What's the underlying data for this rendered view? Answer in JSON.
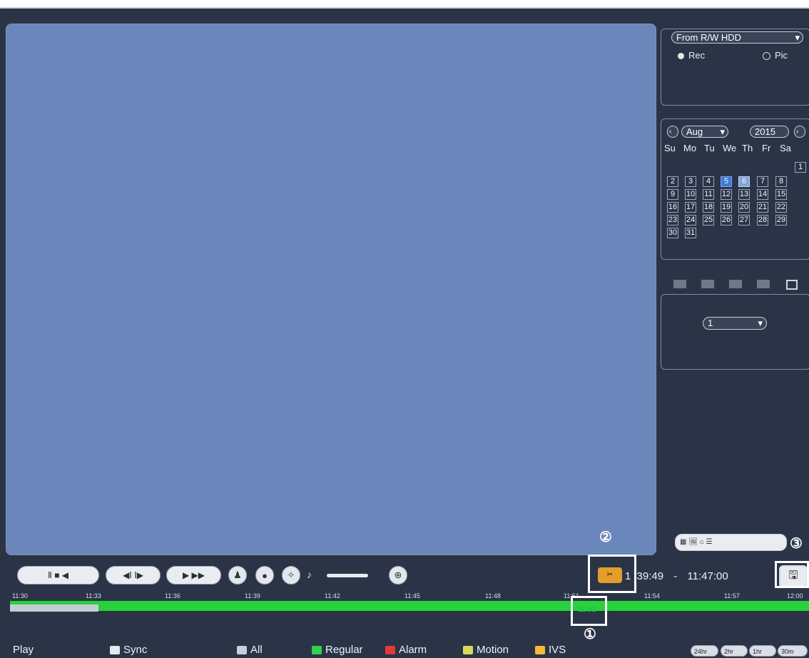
{
  "source": {
    "selected": "From R/W HDD",
    "rec_label": "Rec",
    "pic_label": "Pic"
  },
  "calendar": {
    "month": "Aug",
    "year": "2015",
    "weekdays": [
      "Su",
      "Mo",
      "Tu",
      "We",
      "Th",
      "Fr",
      "Sa"
    ],
    "days": [
      "1",
      "2",
      "3",
      "4",
      "5",
      "6",
      "7",
      "8",
      "9",
      "10",
      "11",
      "12",
      "13",
      "14",
      "15",
      "16",
      "17",
      "18",
      "19",
      "20",
      "21",
      "22",
      "23",
      "24",
      "25",
      "26",
      "27",
      "28",
      "29",
      "30",
      "31"
    ]
  },
  "channel": {
    "selected": "1"
  },
  "time": {
    "start": "1",
    "start_rest": "39:49",
    "dash": "-",
    "end": "11:47:00"
  },
  "timeline_ticks": [
    "11:30",
    "11:33",
    "11:36",
    "11:39",
    "11:42",
    "11:45",
    "11:48",
    "11:51",
    "11:54",
    "11:57",
    "12:00"
  ],
  "playhead_label": "11:51",
  "callouts": [
    "①",
    "②",
    "③"
  ],
  "legend": {
    "play": "Play",
    "sync": "Sync",
    "all": "All",
    "regular": "Regular",
    "alarm": "Alarm",
    "motion": "Motion",
    "ivs": "IVS"
  },
  "zoom": [
    "24hr",
    "2hr",
    "1hr",
    "30m"
  ],
  "colors": {
    "video": "#6b86ba",
    "frame": "#2b3447",
    "timeline": "#27d23b",
    "selected_day": "#3f79d8"
  }
}
